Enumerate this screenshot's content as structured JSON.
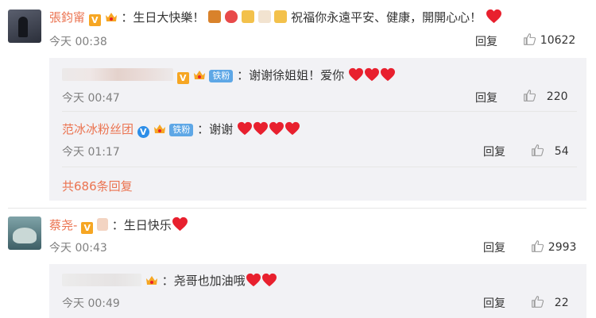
{
  "comments": [
    {
      "author": "張鈞甯",
      "text": "：生日大快樂！",
      "text2": "祝福你永遠平安、健康，開開心心！",
      "time": "今天 00:38",
      "reply_label": "回复",
      "likes": "10622",
      "replies": [
        {
          "text": "：谢谢徐姐姐！爱你",
          "fan_badge": "铁粉",
          "time": "今天 00:47",
          "reply_label": "回复",
          "likes": "220"
        },
        {
          "author": "范冰冰粉丝团",
          "text": "：谢谢",
          "fan_badge": "铁粉",
          "time": "今天 01:17",
          "reply_label": "回复",
          "likes": "54"
        }
      ],
      "more_replies": "共686条回复"
    },
    {
      "author": "蔡尧-",
      "text": "：生日快乐",
      "time": "今天 00:43",
      "reply_label": "回复",
      "likes": "2993",
      "replies": [
        {
          "text": "：尧哥也加油哦",
          "time": "今天 00:49",
          "reply_label": "回复",
          "likes": "22"
        }
      ]
    }
  ],
  "badges": {
    "verified": "V"
  },
  "colors": {
    "name": "#eb7350",
    "heart": "#e8202e",
    "reply_bg": "#f2f2f5",
    "fan_badge": "#5ea7e6"
  }
}
